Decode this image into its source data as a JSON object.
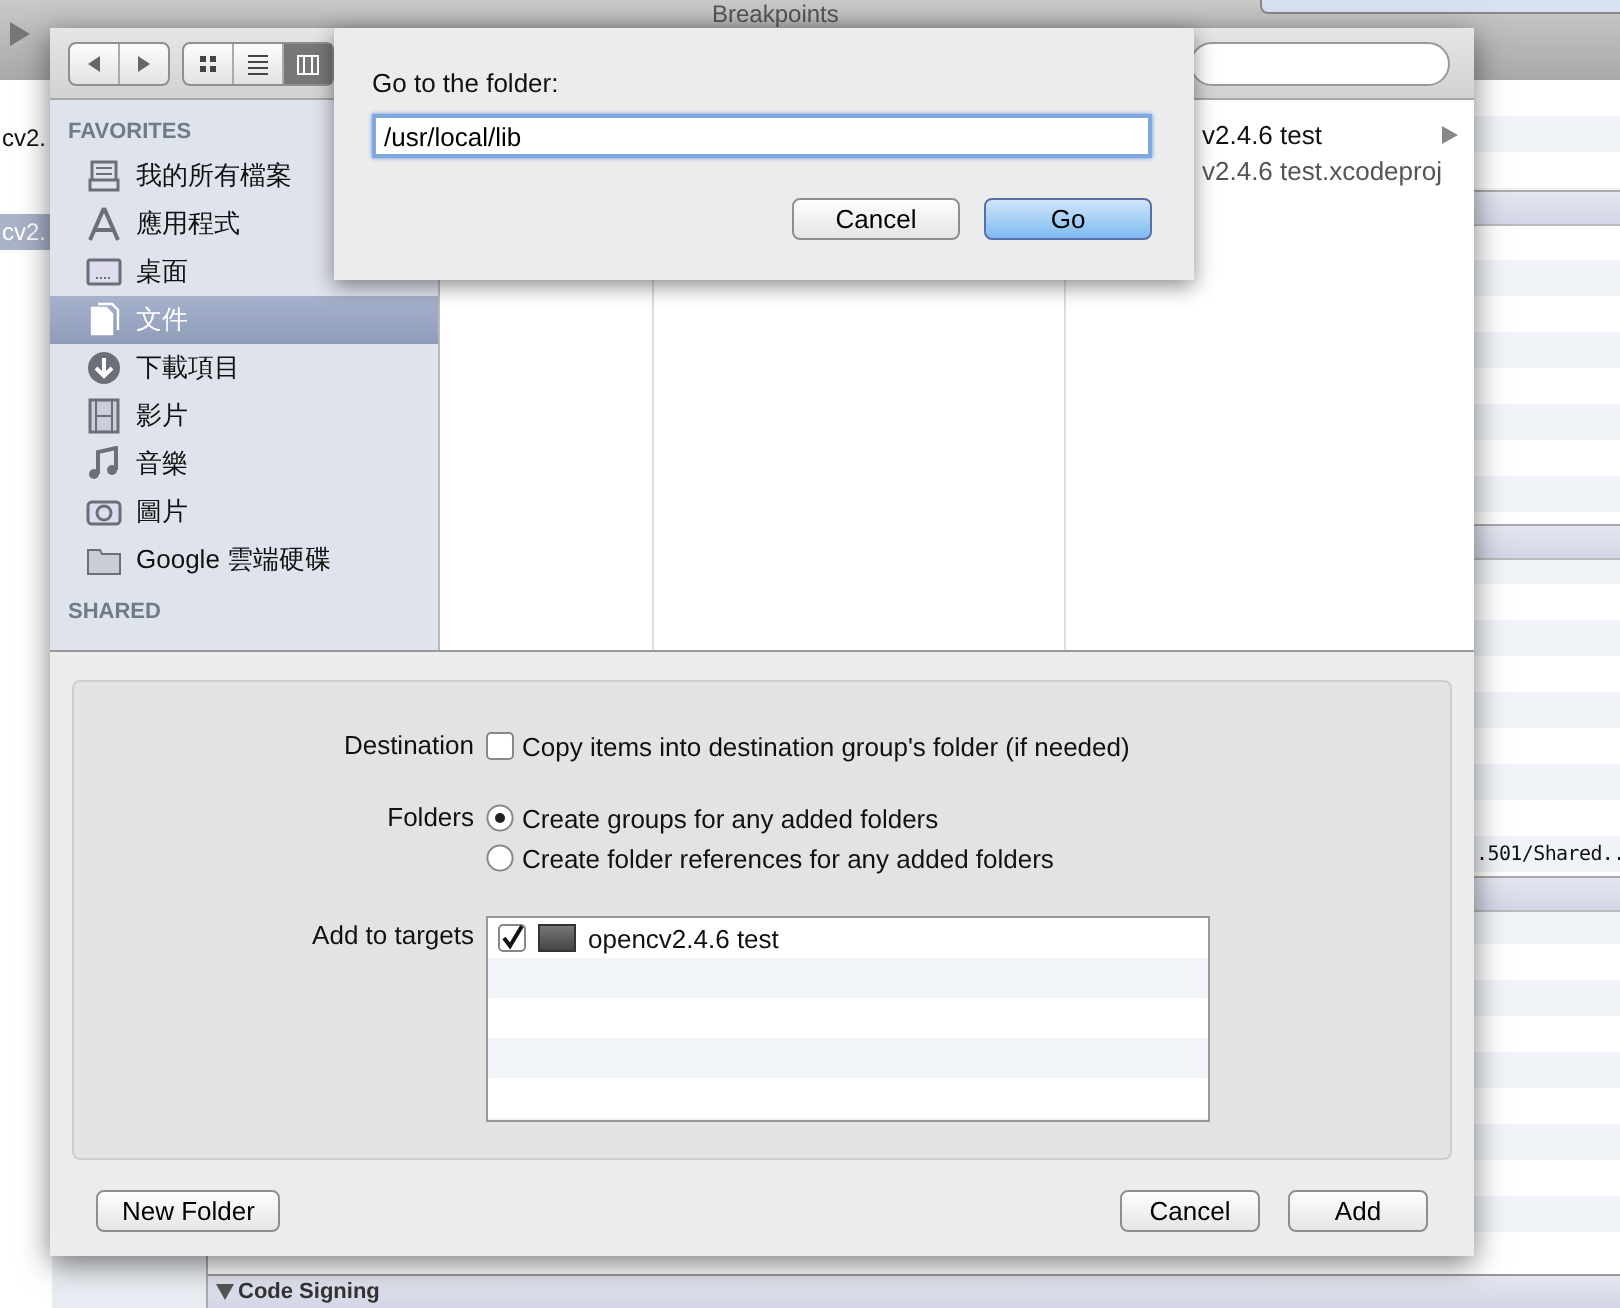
{
  "background_window": {
    "title": "Breakpoints",
    "navigator_items": [
      {
        "label": "cv2.",
        "selected": false
      },
      {
        "label": "cv2.",
        "selected": true
      }
    ],
    "right_text": ".501/Shared..",
    "section_header": "Code Signing"
  },
  "finder": {
    "sidebar": {
      "favorites_title": "FAVORITES",
      "items": [
        {
          "label": "我的所有檔案",
          "kind": "files",
          "selected": false
        },
        {
          "label": "應用程式",
          "kind": "apps",
          "selected": false
        },
        {
          "label": "桌面",
          "kind": "desktop",
          "selected": false
        },
        {
          "label": "文件",
          "kind": "documents",
          "selected": true
        },
        {
          "label": "下載項目",
          "kind": "downloads",
          "selected": false
        },
        {
          "label": "影片",
          "kind": "movies",
          "selected": false
        },
        {
          "label": "音樂",
          "kind": "music",
          "selected": false
        },
        {
          "label": "圖片",
          "kind": "pictures",
          "selected": false
        },
        {
          "label": "Google 雲端硬碟",
          "kind": "folder",
          "selected": false
        }
      ],
      "shared_title": "SHARED"
    },
    "column_items": [
      {
        "label": "v2.4.6 test",
        "has_children": true
      },
      {
        "label": "v2.4.6 test.xcodeproj",
        "has_children": false
      }
    ]
  },
  "options": {
    "destination": {
      "label": "Destination",
      "text": "Copy items into destination group's folder (if needed)",
      "checked": false
    },
    "folders": {
      "label": "Folders",
      "options": [
        {
          "text": "Create groups for any added folders",
          "selected": true
        },
        {
          "text": "Create folder references for any added folders",
          "selected": false
        }
      ]
    },
    "targets": {
      "label": "Add to targets",
      "items": [
        {
          "name": "opencv2.4.6 test",
          "checked": true
        }
      ]
    }
  },
  "buttons": {
    "new_folder": "New Folder",
    "cancel": "Cancel",
    "add": "Add"
  },
  "go_dialog": {
    "title": "Go to the folder:",
    "value": "/usr/local/lib",
    "buttons": [
      {
        "label": "Cancel",
        "default": false
      },
      {
        "label": "Go",
        "default": true
      }
    ]
  }
}
